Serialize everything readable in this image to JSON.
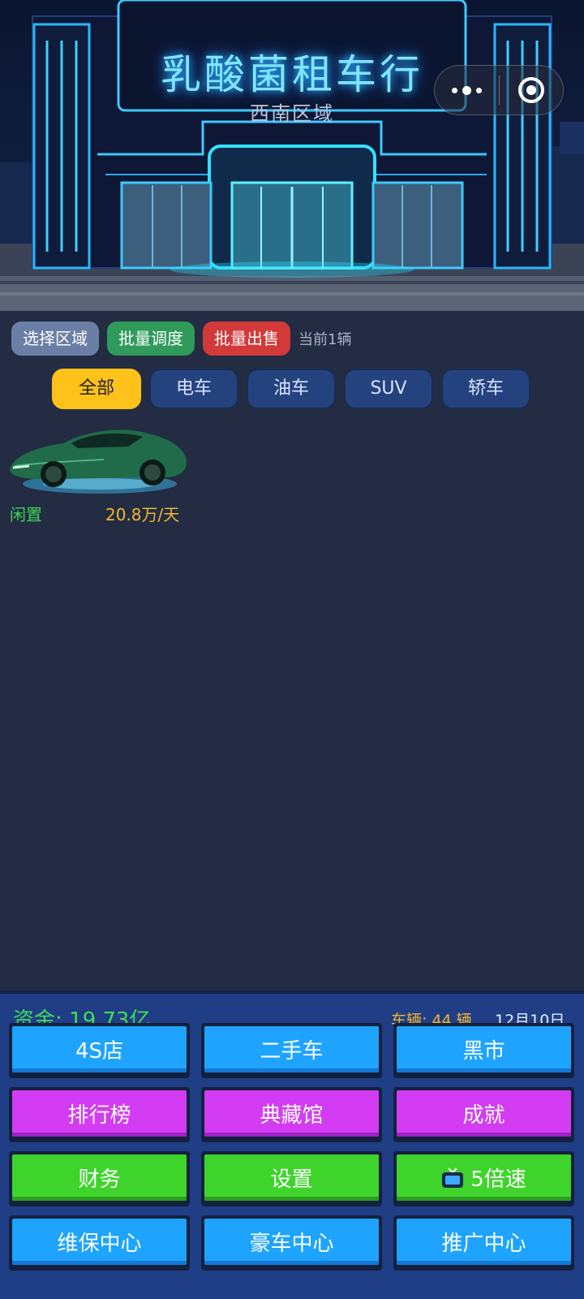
{
  "header": {
    "title": "乳酸菌租车行",
    "subtitle": "西南区域"
  },
  "actions": {
    "select_region": "选择区域",
    "batch_dispatch": "批量调度",
    "batch_sell": "批量出售",
    "current_count": "当前1辆"
  },
  "filters": {
    "tabs": [
      "全部",
      "电车",
      "油车",
      "SUV",
      "轿车"
    ],
    "active": "全部"
  },
  "cars": [
    {
      "status": "闲置",
      "price": "20.8万/天",
      "color": "#1f6b4a"
    }
  ],
  "footer": {
    "funds": "资金: 19.73亿",
    "vehicles": "车辆: 44 辆",
    "date": "12月10日"
  },
  "buttons": {
    "shop_4s": "4S店",
    "used_car": "二手车",
    "black_market": "黑市",
    "leaderboard": "排行榜",
    "collection": "典藏馆",
    "achievement": "成就",
    "finance": "财务",
    "settings": "设置",
    "speed": "5倍速",
    "maintenance": "维保中心",
    "luxury": "豪车中心",
    "promotion": "推广中心"
  },
  "colors": {
    "background": "#232c42",
    "blue_button": "#1ea4ff",
    "purple_button": "#d33cf2",
    "green_button": "#3fd42c",
    "active_tab": "#ffc21a",
    "funds_text": "#3fdc55",
    "price_text": "#f2b731"
  }
}
